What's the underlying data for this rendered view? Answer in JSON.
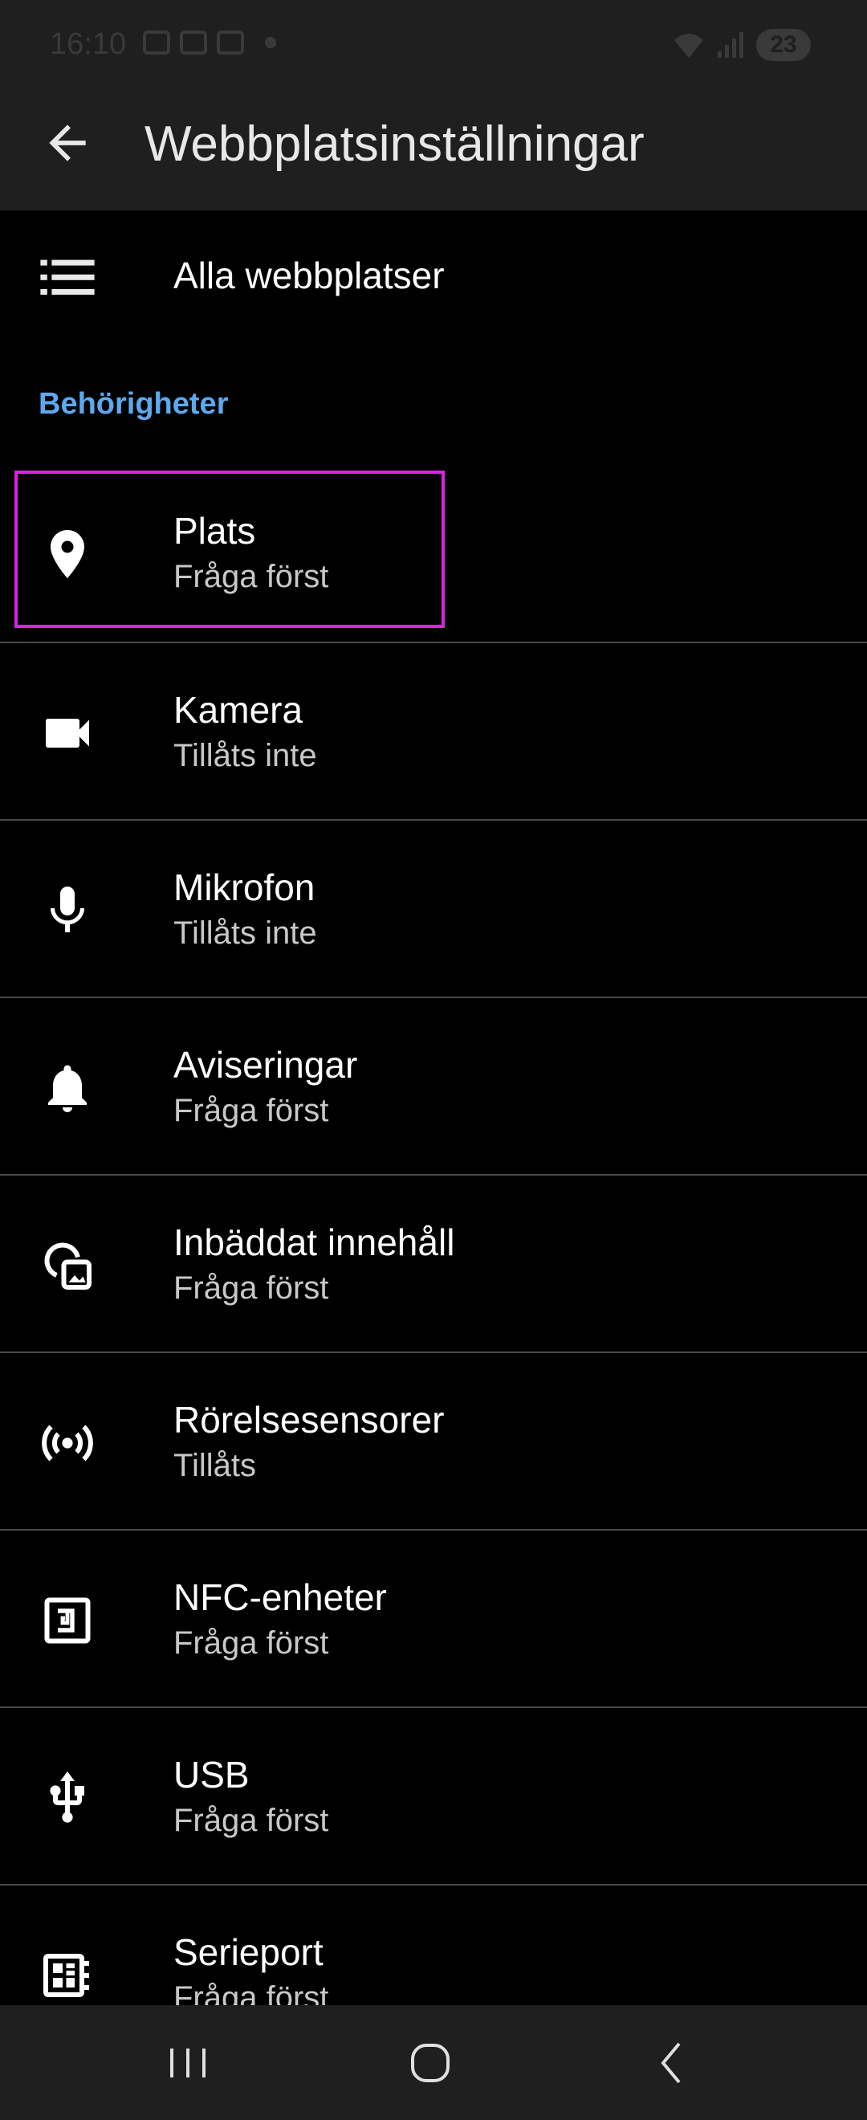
{
  "status": {
    "time": "16:10",
    "battery": "23"
  },
  "app_bar": {
    "title": "Webbplatsinställningar"
  },
  "all_sites": {
    "label": "Alla webbplatser"
  },
  "section": {
    "header": "Behörigheter"
  },
  "permissions": [
    {
      "title": "Plats",
      "subtitle": "Fråga först",
      "icon": "location-pin-icon"
    },
    {
      "title": "Kamera",
      "subtitle": "Tillåts inte",
      "icon": "camera-icon"
    },
    {
      "title": "Mikrofon",
      "subtitle": "Tillåts inte",
      "icon": "microphone-icon"
    },
    {
      "title": "Aviseringar",
      "subtitle": "Fråga först",
      "icon": "bell-icon"
    },
    {
      "title": "Inbäddat innehåll",
      "subtitle": "Fråga först",
      "icon": "embedded-content-icon"
    },
    {
      "title": "Rörelsesensorer",
      "subtitle": "Tillåts",
      "icon": "motion-sensor-icon"
    },
    {
      "title": "NFC-enheter",
      "subtitle": "Fråga först",
      "icon": "nfc-icon"
    },
    {
      "title": "USB",
      "subtitle": "Fråga först",
      "icon": "usb-icon"
    },
    {
      "title": "Serieport",
      "subtitle": "Fråga först",
      "icon": "serial-port-icon"
    }
  ],
  "colors": {
    "accent": "#5da9f0",
    "highlight": "#e020e0",
    "background": "#000000",
    "bar": "#1f1f1f"
  }
}
